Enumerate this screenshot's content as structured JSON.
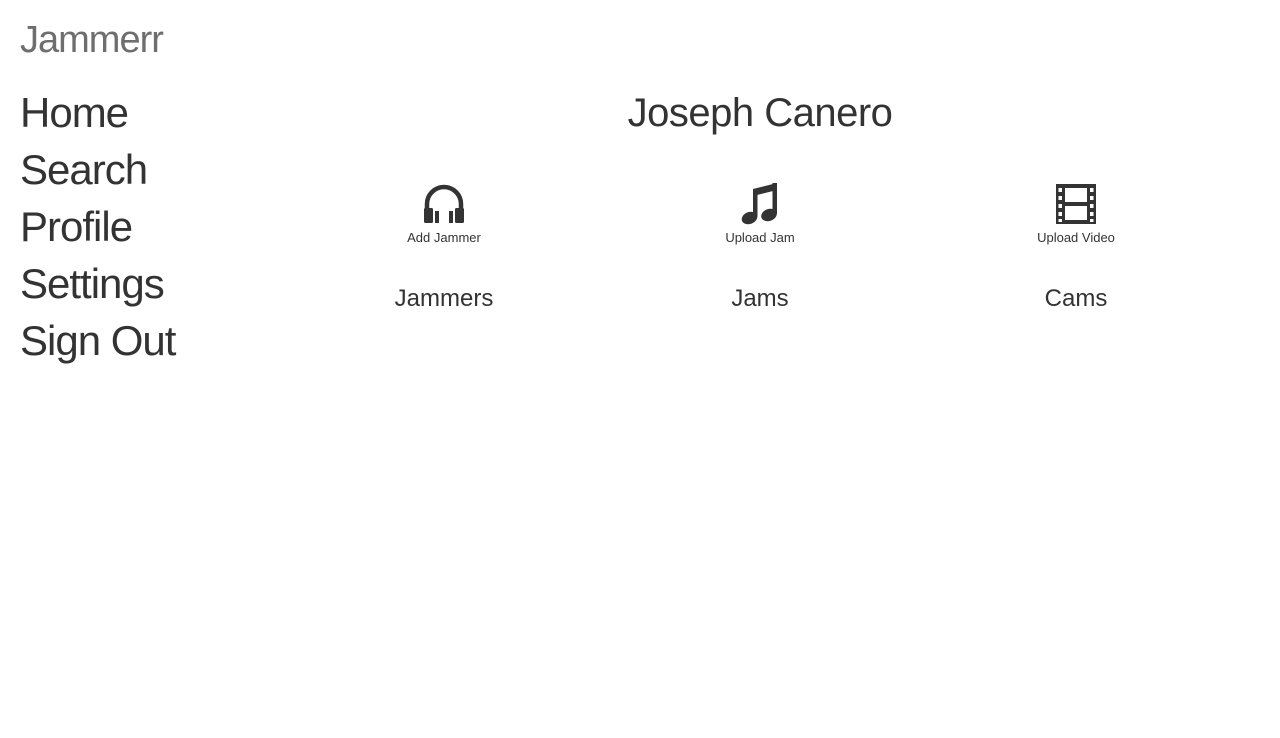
{
  "app": {
    "brand": "Jammerr"
  },
  "sidebar": {
    "items": [
      {
        "label": "Home"
      },
      {
        "label": "Search"
      },
      {
        "label": "Profile"
      },
      {
        "label": "Settings"
      },
      {
        "label": "Sign Out"
      }
    ]
  },
  "profile": {
    "name": "Joseph Canero"
  },
  "actions": [
    {
      "label": "Add Jammer",
      "icon": "headphones-icon"
    },
    {
      "label": "Upload Jam",
      "icon": "music-note-icon"
    },
    {
      "label": "Upload Video",
      "icon": "film-icon"
    }
  ],
  "sections": [
    {
      "title": "Jammers"
    },
    {
      "title": "Jams"
    },
    {
      "title": "Cams"
    }
  ],
  "colors": {
    "text": "#333333",
    "brand": "#6e6e6e",
    "background": "#ffffff"
  }
}
